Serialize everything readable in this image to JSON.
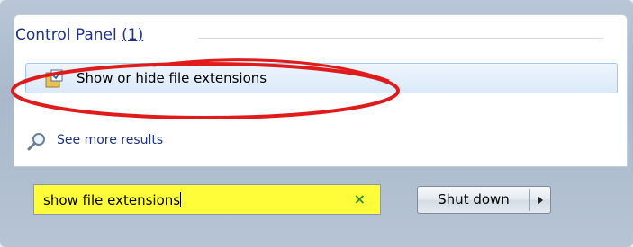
{
  "start_menu": {
    "results_section": {
      "title": "Control Panel",
      "count": "(1)"
    },
    "result_item": {
      "label": "Show or hide file extensions",
      "icon": "folder-options-icon"
    },
    "see_more": {
      "label": "See more results",
      "icon": "search-icon"
    },
    "search": {
      "value": "show file extensions",
      "clear_icon": "×",
      "highlight_color": "#fffd3a"
    },
    "shutdown": {
      "label": "Shut down",
      "arrow_icon": "chevron-right-icon"
    },
    "annotation": {
      "ring_color": "#e01b1b"
    }
  }
}
